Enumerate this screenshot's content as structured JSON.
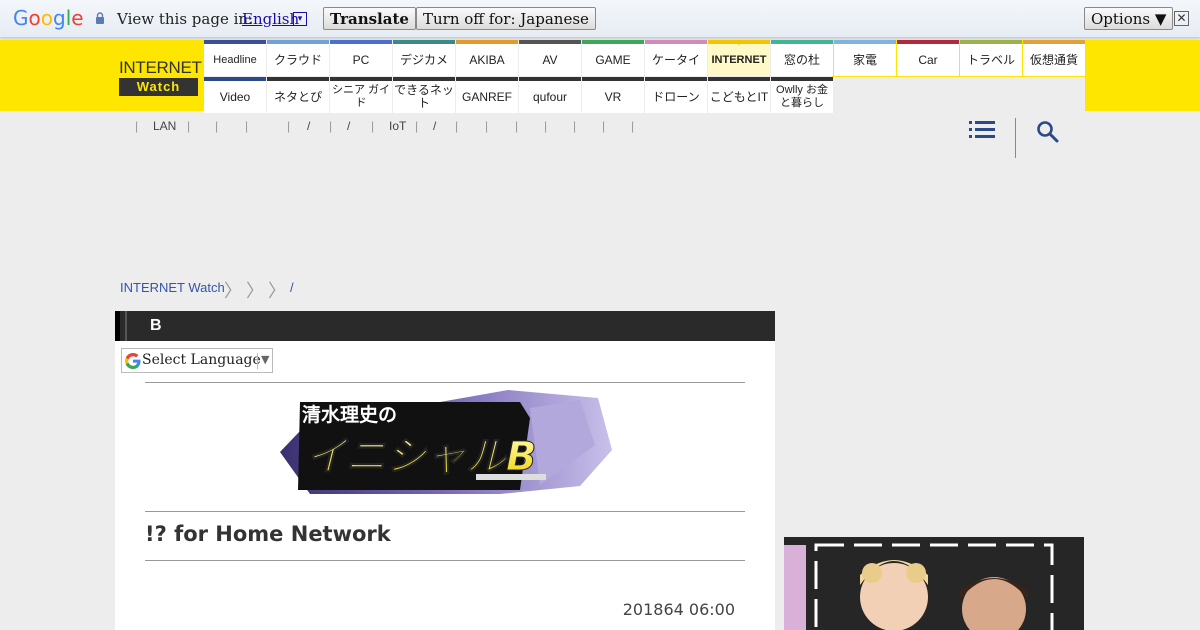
{
  "translate_bar": {
    "logo_letters": [
      "G",
      "o",
      "o",
      "g",
      "l",
      "e"
    ],
    "view_text": "View this page in:",
    "language": "English",
    "dropdown_glyph": "▾",
    "translate_label": "Translate",
    "turn_off_label": "Turn off for: Japanese",
    "options_label": "Options ▼",
    "close_glyph": "✕"
  },
  "site": {
    "logo_top": "INTERNET",
    "logo_bottom": "Watch"
  },
  "nav": {
    "row1": [
      {
        "label": "Headline",
        "color": "#3a4f9a"
      },
      {
        "label": "クラウド",
        "color": "#6fa3d8"
      },
      {
        "label": "PC",
        "color": "#4a6fd0"
      },
      {
        "label": "デジカメ",
        "color": "#3a8a8a"
      },
      {
        "label": "AKIBA",
        "color": "#e39a2a"
      },
      {
        "label": "AV",
        "color": "#555555"
      },
      {
        "label": "GAME",
        "color": "#3aaa5a"
      },
      {
        "label": "ケータイ",
        "color": "#d18ac0"
      },
      {
        "label": "INTERNET",
        "color": "#f5c400",
        "active": true
      },
      {
        "label": "窓の杜",
        "color": "#45b39a"
      },
      {
        "label": "家電",
        "color": "#7fb3e0"
      },
      {
        "label": "Car",
        "color": "#b3283c"
      },
      {
        "label": "トラベル",
        "color": "#9ab34a"
      },
      {
        "label": "仮想通貨",
        "color": "#e0a23a"
      }
    ],
    "row2": [
      {
        "label": "Video",
        "color": "#2b4a8a"
      },
      {
        "label": "ネタとぴ",
        "color": "#333333"
      },
      {
        "label": "シニア ガイド",
        "color": "#333333"
      },
      {
        "label": "できるネット",
        "color": "#333333"
      },
      {
        "label": "GANREF",
        "color": "#333333"
      },
      {
        "label": "qufour",
        "color": "#333333"
      },
      {
        "label": "VR",
        "color": "#333333"
      },
      {
        "label": "ドローン",
        "color": "#333333"
      },
      {
        "label": "こどもとIT",
        "color": "#333333"
      },
      {
        "label": "Owlly お金と暮らし",
        "color": "#333333"
      }
    ]
  },
  "subnav": {
    "items": [
      "|",
      "LAN",
      "|",
      "|",
      "|",
      "|",
      "/",
      "|",
      "/",
      "|",
      "IoT",
      "|",
      "/",
      "|",
      "|",
      "|",
      "|",
      "|",
      "|",
      "|"
    ]
  },
  "icons": {
    "menu": "menu-icon",
    "search": "search-icon"
  },
  "breadcrumb": {
    "home": "INTERNET Watch",
    "chevrons": [
      "〉",
      "〉",
      "〉"
    ],
    "tail": "/"
  },
  "panel": {
    "heading": "B",
    "language_select": "Select Language",
    "language_arrow": "▼",
    "banner_text_top": "清水理史の",
    "banner_text_main": "イニシャルB",
    "article_title": "!? for Home Network",
    "article_date": "201864 06:00"
  },
  "colors": {
    "brand_yellow": "#ffe600",
    "link_blue": "#3355aa",
    "header_dark": "#2a2a2a"
  }
}
